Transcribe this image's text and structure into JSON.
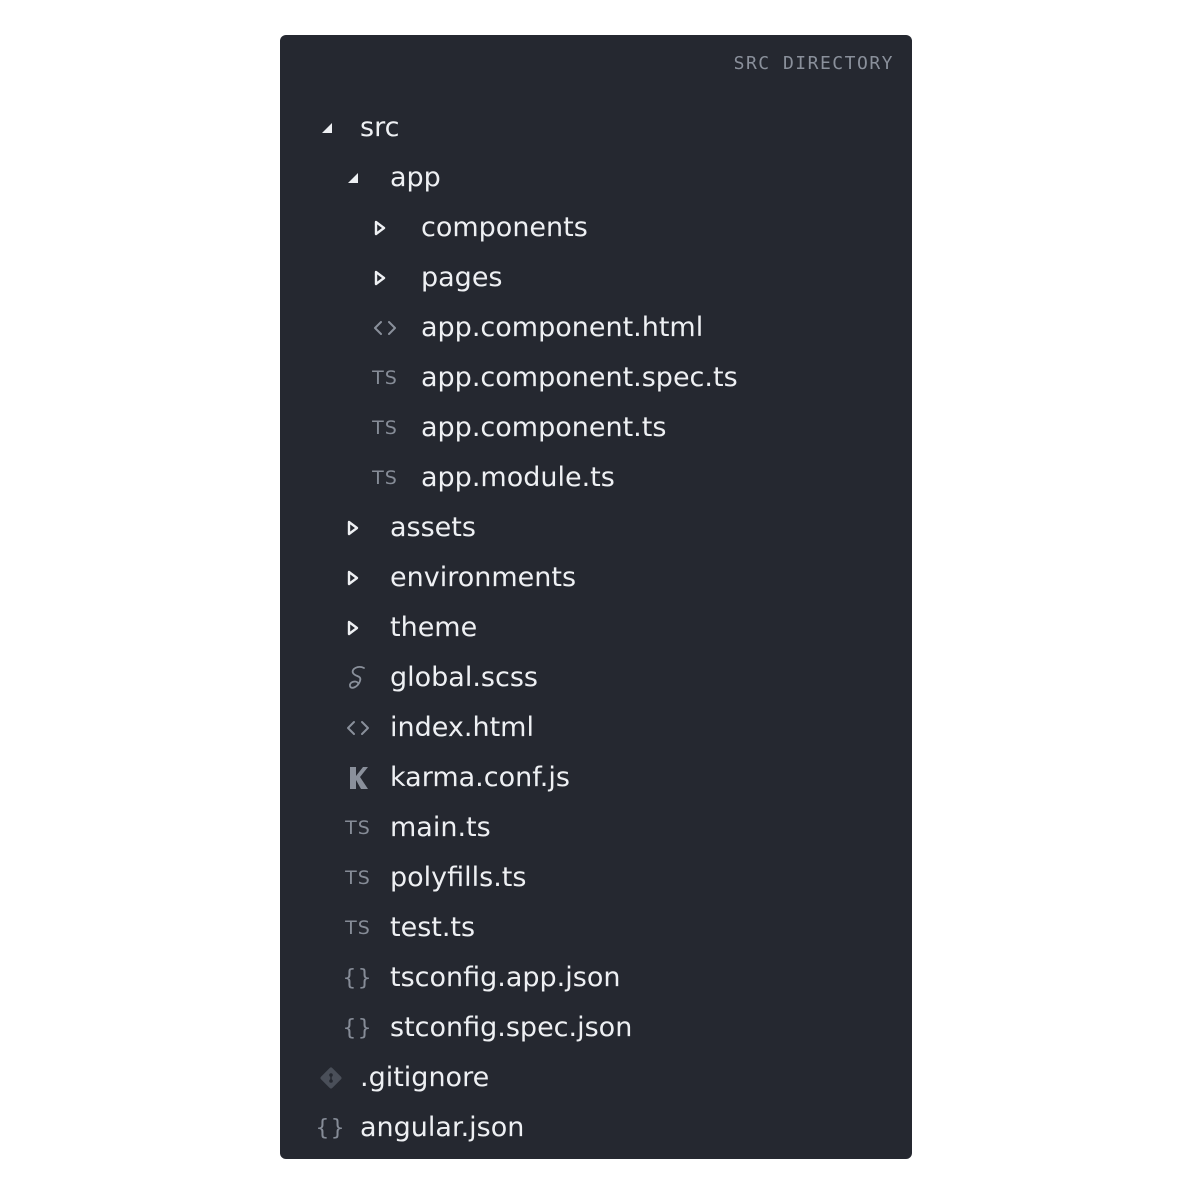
{
  "panel": {
    "title": "SRC DIRECTORY",
    "background": "#252830"
  },
  "tree": [
    {
      "label": "src",
      "type": "folder",
      "expanded": true,
      "icon": "triangle-expanded-icon",
      "depth": 0
    },
    {
      "label": "app",
      "type": "folder",
      "expanded": true,
      "icon": "triangle-expanded-icon",
      "depth": 1
    },
    {
      "label": "components",
      "type": "folder",
      "expanded": false,
      "icon": "triangle-collapsed-icon",
      "depth": 2
    },
    {
      "label": "pages",
      "type": "folder",
      "expanded": false,
      "icon": "triangle-collapsed-icon",
      "depth": 2
    },
    {
      "label": "app.component.html",
      "type": "file",
      "icon": "html-icon",
      "icon_text": "<>",
      "depth": 2
    },
    {
      "label": "app.component.spec.ts",
      "type": "file",
      "icon": "typescript-icon",
      "icon_text": "TS",
      "depth": 2
    },
    {
      "label": "app.component.ts",
      "type": "file",
      "icon": "typescript-icon",
      "icon_text": "TS",
      "depth": 2
    },
    {
      "label": "app.module.ts",
      "type": "file",
      "icon": "typescript-icon",
      "icon_text": "TS",
      "depth": 2
    },
    {
      "label": "assets",
      "type": "folder",
      "expanded": false,
      "icon": "triangle-collapsed-icon",
      "depth": 1
    },
    {
      "label": "environments",
      "type": "folder",
      "expanded": false,
      "icon": "triangle-collapsed-icon",
      "depth": 1
    },
    {
      "label": "theme",
      "type": "folder",
      "expanded": false,
      "icon": "triangle-collapsed-icon",
      "depth": 1
    },
    {
      "label": "global.scss",
      "type": "file",
      "icon": "sass-icon",
      "depth": 1
    },
    {
      "label": "index.html",
      "type": "file",
      "icon": "html-icon",
      "icon_text": "<>",
      "depth": 1
    },
    {
      "label": "karma.conf.js",
      "type": "file",
      "icon": "karma-icon",
      "depth": 1
    },
    {
      "label": "main.ts",
      "type": "file",
      "icon": "typescript-icon",
      "icon_text": "TS",
      "depth": 1
    },
    {
      "label": "polyfills.ts",
      "type": "file",
      "icon": "typescript-icon",
      "icon_text": "TS",
      "depth": 1
    },
    {
      "label": "test.ts",
      "type": "file",
      "icon": "typescript-icon",
      "icon_text": "TS",
      "depth": 1
    },
    {
      "label": "tsconfig.app.json",
      "type": "file",
      "icon": "json-icon",
      "icon_text": "{}",
      "depth": 1
    },
    {
      "label": "stconfig.spec.json",
      "type": "file",
      "icon": "json-icon",
      "icon_text": "{}",
      "depth": 1
    },
    {
      "label": ".gitignore",
      "type": "file",
      "icon": "git-icon",
      "depth": 0
    },
    {
      "label": "angular.json",
      "type": "file",
      "icon": "json-icon",
      "icon_text": "{}",
      "depth": 0
    }
  ]
}
